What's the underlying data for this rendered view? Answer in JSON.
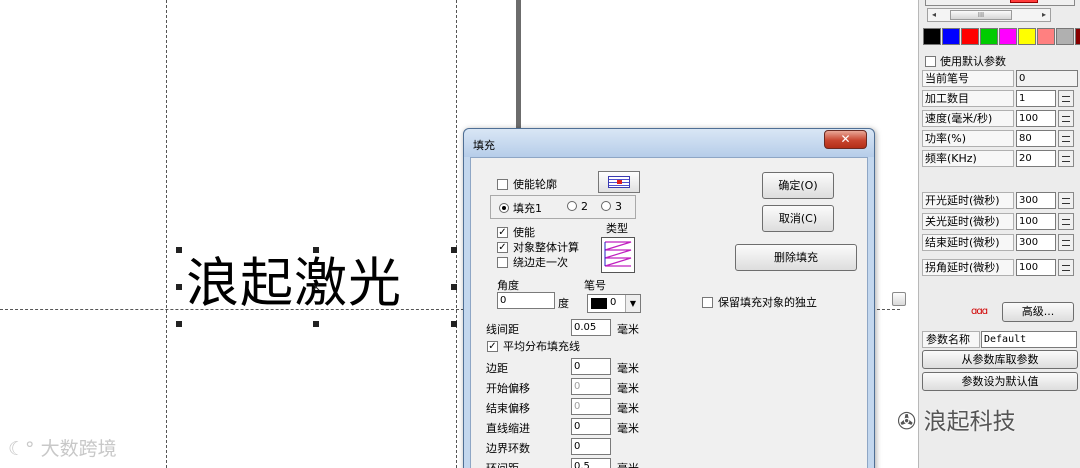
{
  "canvas": {
    "text": "浪起激光",
    "center_mark": "×"
  },
  "watermarks": {
    "left": "大数跨境",
    "right": "浪起科技"
  },
  "panel": {
    "scroll_thumb": "III",
    "scroll_left_arrow": "◂",
    "scroll_right_arrow": "▸",
    "swatch_colors": [
      "#000000",
      "#0000ff",
      "#ff0000",
      "#00cc00",
      "#ff00ff",
      "#ffff00",
      "#ff8080",
      "#b0b0b0",
      "#880000"
    ],
    "use_default_params": "使用默认参数",
    "params": [
      {
        "label": "当前笔号",
        "value": "0"
      },
      {
        "label": "加工数目",
        "value": "1"
      },
      {
        "label": "速度(毫米/秒)",
        "value": "100"
      },
      {
        "label": "功率(%)",
        "value": "80"
      },
      {
        "label": "频率(KHz)",
        "value": "20"
      },
      {
        "label": "开光延时(微秒)",
        "value": "300"
      },
      {
        "label": "关光延时(微秒)",
        "value": "100"
      },
      {
        "label": "结束延时(微秒)",
        "value": "300"
      },
      {
        "label": "拐角延时(微秒)",
        "value": "100"
      }
    ],
    "advanced_icon": "ɑɑɑ",
    "advanced_button": "高级...",
    "param_name_label": "参数名称",
    "param_name_value": "Default",
    "load_from_library": "从参数库取参数",
    "set_as_default": "参数设为默认值"
  },
  "dialog": {
    "title": "填充",
    "close": "✕",
    "enable_outline": "使能轮廓",
    "fill_tabs": [
      {
        "label": "填充1",
        "selected": true
      },
      {
        "label": "2",
        "selected": false
      },
      {
        "label": "3",
        "selected": false
      }
    ],
    "enable": "使能",
    "whole_object_calc": "对象整体计算",
    "walk_edge_once": "绕边走一次",
    "type_label": "类型",
    "angle_label": "角度",
    "angle_value": "0",
    "angle_unit": "度",
    "pen_label": "笔号",
    "pen_value": "0",
    "dropdown_arrow": "▼",
    "keep_fill_independent": "保留填充对象的独立",
    "ok_button": "确定(O)",
    "cancel_button": "取消(C)",
    "delete_fill_button": "删除填充",
    "line_spacing_label": "线间距",
    "line_spacing_value": "0.05",
    "mm": "毫米",
    "avg_distribute": "平均分布填充线",
    "rows": [
      {
        "label": "边距",
        "value": "0",
        "unit": "毫米",
        "disabled": false
      },
      {
        "label": "开始偏移",
        "value": "0",
        "unit": "毫米",
        "disabled": true
      },
      {
        "label": "结束偏移",
        "value": "0",
        "unit": "毫米",
        "disabled": true
      },
      {
        "label": "直线缩进",
        "value": "0",
        "unit": "毫米",
        "disabled": false
      },
      {
        "label": "边界环数",
        "value": "0",
        "unit": "",
        "disabled": false
      },
      {
        "label": "环间距",
        "value": "0.5",
        "unit": "毫米",
        "disabled": false
      }
    ]
  }
}
